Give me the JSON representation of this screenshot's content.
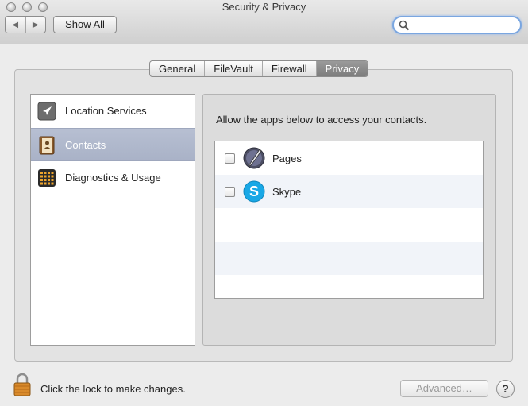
{
  "window": {
    "title": "Security & Privacy"
  },
  "toolbar": {
    "back_label": "◀",
    "forward_label": "▶",
    "show_all_label": "Show All",
    "search_placeholder": ""
  },
  "tabs": [
    {
      "label": "General",
      "active": false
    },
    {
      "label": "FileVault",
      "active": false
    },
    {
      "label": "Firewall",
      "active": false
    },
    {
      "label": "Privacy",
      "active": true
    }
  ],
  "sidebar": {
    "items": [
      {
        "label": "Location Services",
        "icon": "location-arrow-icon",
        "selected": false
      },
      {
        "label": "Contacts",
        "icon": "contacts-book-icon",
        "selected": true
      },
      {
        "label": "Diagnostics & Usage",
        "icon": "diagnostics-grid-icon",
        "selected": false
      }
    ]
  },
  "main": {
    "prompt": "Allow the apps below to access your contacts.",
    "apps": [
      {
        "name": "Pages",
        "icon": "pages-pen-icon",
        "checked": false
      },
      {
        "name": "Skype",
        "icon": "skype-icon",
        "checked": false
      }
    ]
  },
  "footer": {
    "lock_text": "Click the lock to make changes.",
    "advanced_label": "Advanced…",
    "help_label": "?"
  }
}
